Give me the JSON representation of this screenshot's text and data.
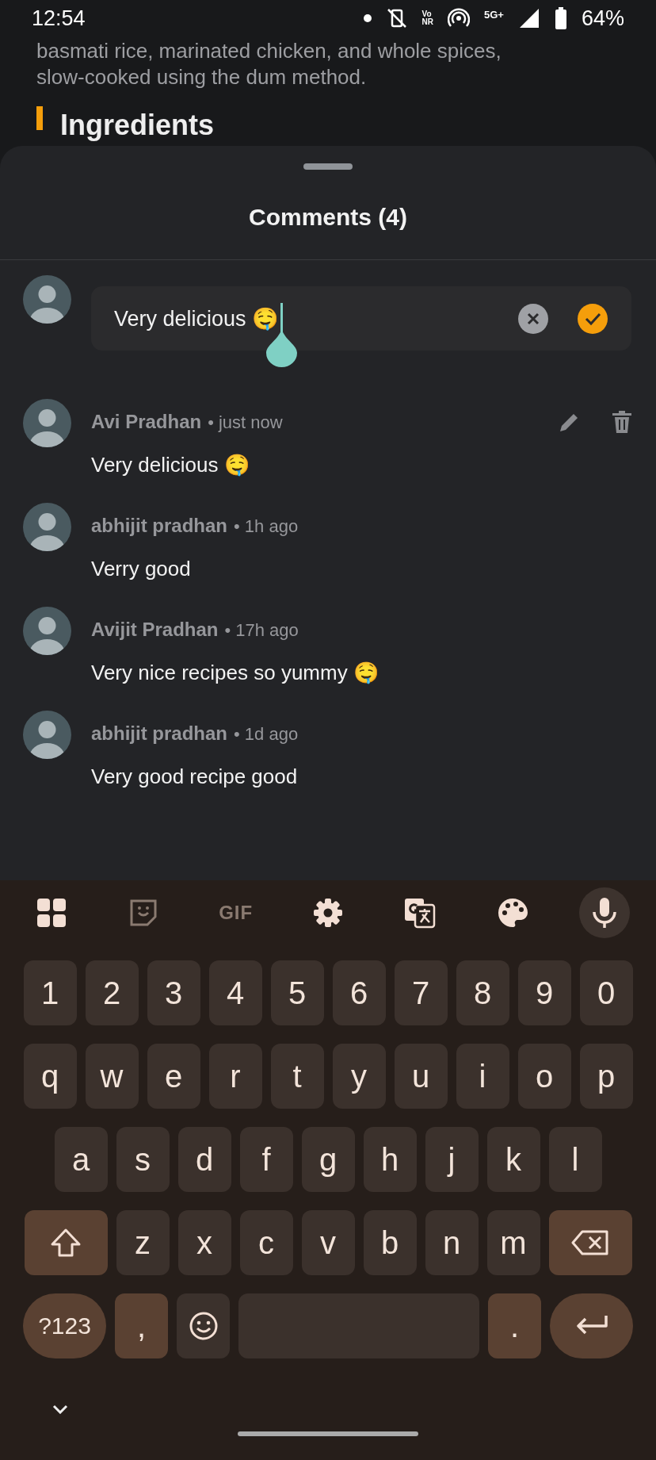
{
  "background": {
    "lines": [
      "basmati rice, marinated chicken, and whole spices,",
      "slow-cooked using the dum method."
    ],
    "section_heading": "Ingredients"
  },
  "status_bar": {
    "time": "12:54",
    "network_badge": [
      "Vo",
      "NR"
    ],
    "network_type": "5G+",
    "battery": "64%"
  },
  "sheet": {
    "title": "Comments (4)",
    "composer": {
      "value": "Very delicious 🤤"
    },
    "comments": [
      {
        "author": "Avi Pradhan",
        "time": "• just now",
        "text": "Very delicious 🤤",
        "own": true
      },
      {
        "author": "abhijit pradhan",
        "time": "• 1h ago",
        "text": "Verry good",
        "own": false
      },
      {
        "author": "Avijit Pradhan",
        "time": "• 17h ago",
        "text": "Very nice recipes so yummy 🤤",
        "own": false
      },
      {
        "author": "abhijit pradhan",
        "time": "• 1d ago",
        "text": "Very good recipe good",
        "own": false
      }
    ]
  },
  "keyboard": {
    "toolbar": [
      {
        "kind": "grid"
      },
      {
        "kind": "sticker"
      },
      {
        "kind": "gif",
        "label": "GIF"
      },
      {
        "kind": "settings"
      },
      {
        "kind": "translate"
      },
      {
        "kind": "palette"
      },
      {
        "kind": "mic"
      }
    ],
    "rows": [
      [
        {
          "kind": "char",
          "label": "1"
        },
        {
          "kind": "char",
          "label": "2"
        },
        {
          "kind": "char",
          "label": "3"
        },
        {
          "kind": "char",
          "label": "4"
        },
        {
          "kind": "char",
          "label": "5"
        },
        {
          "kind": "char",
          "label": "6"
        },
        {
          "kind": "char",
          "label": "7"
        },
        {
          "kind": "char",
          "label": "8"
        },
        {
          "kind": "char",
          "label": "9"
        },
        {
          "kind": "char",
          "label": "0"
        }
      ],
      [
        {
          "kind": "char",
          "label": "q"
        },
        {
          "kind": "char",
          "label": "w"
        },
        {
          "kind": "char",
          "label": "e"
        },
        {
          "kind": "char",
          "label": "r"
        },
        {
          "kind": "char",
          "label": "t"
        },
        {
          "kind": "char",
          "label": "y"
        },
        {
          "kind": "char",
          "label": "u"
        },
        {
          "kind": "char",
          "label": "i"
        },
        {
          "kind": "char",
          "label": "o"
        },
        {
          "kind": "char",
          "label": "p"
        }
      ],
      [
        {
          "kind": "char",
          "label": "a"
        },
        {
          "kind": "char",
          "label": "s"
        },
        {
          "kind": "char",
          "label": "d"
        },
        {
          "kind": "char",
          "label": "f"
        },
        {
          "kind": "char",
          "label": "g"
        },
        {
          "kind": "char",
          "label": "h"
        },
        {
          "kind": "char",
          "label": "j"
        },
        {
          "kind": "char",
          "label": "k"
        },
        {
          "kind": "char",
          "label": "l"
        }
      ],
      [
        {
          "kind": "shift"
        },
        {
          "kind": "char",
          "label": "z"
        },
        {
          "kind": "char",
          "label": "x"
        },
        {
          "kind": "char",
          "label": "c"
        },
        {
          "kind": "char",
          "label": "v"
        },
        {
          "kind": "char",
          "label": "b"
        },
        {
          "kind": "char",
          "label": "n"
        },
        {
          "kind": "char",
          "label": "m"
        },
        {
          "kind": "backspace"
        }
      ],
      [
        {
          "kind": "mode",
          "label": "?123"
        },
        {
          "kind": "punct",
          "label": ","
        },
        {
          "kind": "emoji"
        },
        {
          "kind": "space"
        },
        {
          "kind": "punct",
          "label": "."
        },
        {
          "kind": "enter"
        }
      ]
    ]
  }
}
